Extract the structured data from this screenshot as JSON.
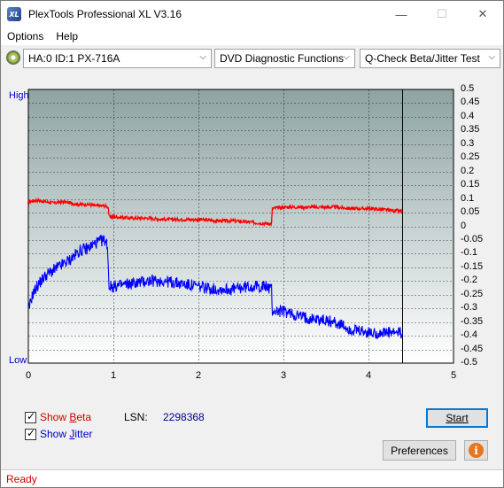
{
  "window": {
    "title": "PlexTools Professional XL V3.16",
    "icon_text": "XL"
  },
  "title_buttons": {
    "minimize": "—",
    "maximize": "☐",
    "close": "✕"
  },
  "menu": {
    "options": "Options",
    "help": "Help"
  },
  "toolbar": {
    "drive": "HA:0 ID:1  PX-716A",
    "function": "DVD Diagnostic Functions",
    "test": "Q-Check Beta/Jitter Test",
    "arrow": "⌵"
  },
  "chart_data": {
    "type": "line",
    "y_left_labels": {
      "high": "High",
      "low": "Low"
    },
    "y_right_ticks": [
      "0.5",
      "0.45",
      "0.4",
      "0.35",
      "0.3",
      "0.25",
      "0.2",
      "0.15",
      "0.1",
      "0.05",
      "0",
      "-0.05",
      "-0.1",
      "-0.15",
      "-0.2",
      "-0.25",
      "-0.3",
      "-0.35",
      "-0.4",
      "-0.45",
      "-0.5"
    ],
    "x_ticks": [
      "0",
      "1",
      "2",
      "3",
      "4",
      "5"
    ],
    "xlim": [
      0,
      5
    ],
    "ylim": [
      -0.5,
      0.5
    ],
    "grid": true,
    "end_marker_x": 4.4,
    "series": [
      {
        "name": "Beta",
        "color": "#ff0000",
        "points": [
          [
            0.0,
            0.09
          ],
          [
            0.1,
            0.095
          ],
          [
            0.2,
            0.09
          ],
          [
            0.3,
            0.085
          ],
          [
            0.4,
            0.09
          ],
          [
            0.5,
            0.085
          ],
          [
            0.6,
            0.08
          ],
          [
            0.7,
            0.08
          ],
          [
            0.8,
            0.075
          ],
          [
            0.9,
            0.075
          ],
          [
            0.94,
            0.07
          ],
          [
            0.95,
            0.035
          ],
          [
            1.0,
            0.035
          ],
          [
            1.2,
            0.03
          ],
          [
            1.4,
            0.03
          ],
          [
            1.6,
            0.025
          ],
          [
            1.8,
            0.025
          ],
          [
            2.0,
            0.025
          ],
          [
            2.2,
            0.02
          ],
          [
            2.4,
            0.02
          ],
          [
            2.6,
            0.015
          ],
          [
            2.8,
            0.01
          ],
          [
            2.86,
            0.01
          ],
          [
            2.87,
            0.065
          ],
          [
            3.0,
            0.07
          ],
          [
            3.2,
            0.07
          ],
          [
            3.4,
            0.07
          ],
          [
            3.6,
            0.07
          ],
          [
            3.8,
            0.065
          ],
          [
            4.0,
            0.065
          ],
          [
            4.2,
            0.06
          ],
          [
            4.4,
            0.055
          ]
        ]
      },
      {
        "name": "Jitter",
        "color": "#0000ff",
        "points": [
          [
            0.0,
            -0.31
          ],
          [
            0.05,
            -0.25
          ],
          [
            0.1,
            -0.22
          ],
          [
            0.2,
            -0.18
          ],
          [
            0.3,
            -0.16
          ],
          [
            0.4,
            -0.14
          ],
          [
            0.5,
            -0.12
          ],
          [
            0.6,
            -0.09
          ],
          [
            0.7,
            -0.08
          ],
          [
            0.8,
            -0.06
          ],
          [
            0.9,
            -0.05
          ],
          [
            0.93,
            -0.07
          ],
          [
            0.95,
            -0.22
          ],
          [
            1.0,
            -0.22
          ],
          [
            1.2,
            -0.21
          ],
          [
            1.4,
            -0.2
          ],
          [
            1.6,
            -0.2
          ],
          [
            1.8,
            -0.21
          ],
          [
            2.0,
            -0.22
          ],
          [
            2.2,
            -0.23
          ],
          [
            2.4,
            -0.23
          ],
          [
            2.6,
            -0.22
          ],
          [
            2.8,
            -0.22
          ],
          [
            2.86,
            -0.23
          ],
          [
            2.87,
            -0.31
          ],
          [
            3.0,
            -0.31
          ],
          [
            3.2,
            -0.33
          ],
          [
            3.4,
            -0.34
          ],
          [
            3.6,
            -0.35
          ],
          [
            3.8,
            -0.38
          ],
          [
            4.0,
            -0.39
          ],
          [
            4.2,
            -0.39
          ],
          [
            4.4,
            -0.39
          ]
        ]
      }
    ]
  },
  "options": {
    "show_beta": "Show Beta",
    "show_beta_accel": "B",
    "show_jitter": "Show Jitter",
    "show_jitter_accel": "J",
    "beta_color": "#cc0000",
    "jitter_color": "#0000cc"
  },
  "lsn": {
    "label": "LSN:",
    "value": "2298368"
  },
  "buttons": {
    "start": "Start",
    "preferences": "Preferences",
    "info": "i"
  },
  "status": {
    "text": "Ready",
    "color": "#cc0000"
  }
}
